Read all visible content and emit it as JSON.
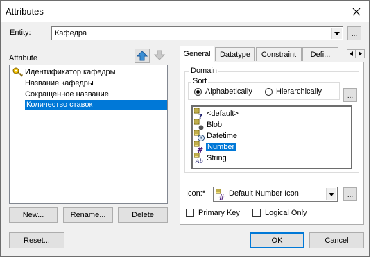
{
  "window": {
    "title": "Attributes"
  },
  "entity": {
    "label": "Entity:",
    "value": "Кафедра",
    "browse": "..."
  },
  "attributes": {
    "label": "Attribute",
    "items": [
      {
        "text": "Идентификатор кафедры",
        "icon": "key-icon"
      },
      {
        "text": "Название кафедры"
      },
      {
        "text": "Сокращенное название"
      },
      {
        "text": "Количество ставок",
        "selected": true
      }
    ]
  },
  "buttons": {
    "new": "New...",
    "rename": "Rename...",
    "delete": "Delete",
    "reset": "Reset...",
    "ok": "OK",
    "cancel": "Cancel"
  },
  "tabs": [
    "General",
    "Datatype",
    "Constraint",
    "Defi..."
  ],
  "domain": {
    "label": "Domain",
    "sort": {
      "label": "Sort",
      "options": [
        "Alphabetically",
        "Hierarchically"
      ],
      "selected": "Alphabetically"
    },
    "sort_more": "...",
    "items": [
      {
        "text": "<default>",
        "icon": "question-icon"
      },
      {
        "text": "Blob",
        "icon": "blob-icon"
      },
      {
        "text": "Datetime",
        "icon": "clock-icon"
      },
      {
        "text": "Number",
        "icon": "hash-icon",
        "selected": true
      },
      {
        "text": "String",
        "icon": "abc-icon"
      }
    ]
  },
  "icon_field": {
    "label": "Icon:*",
    "value": "Default Number Icon",
    "browse": "..."
  },
  "checkboxes": {
    "primary_key": "Primary Key",
    "logical_only": "Logical Only"
  },
  "colors": {
    "selection": "#0078d7",
    "accent_border": "#0078d7"
  }
}
